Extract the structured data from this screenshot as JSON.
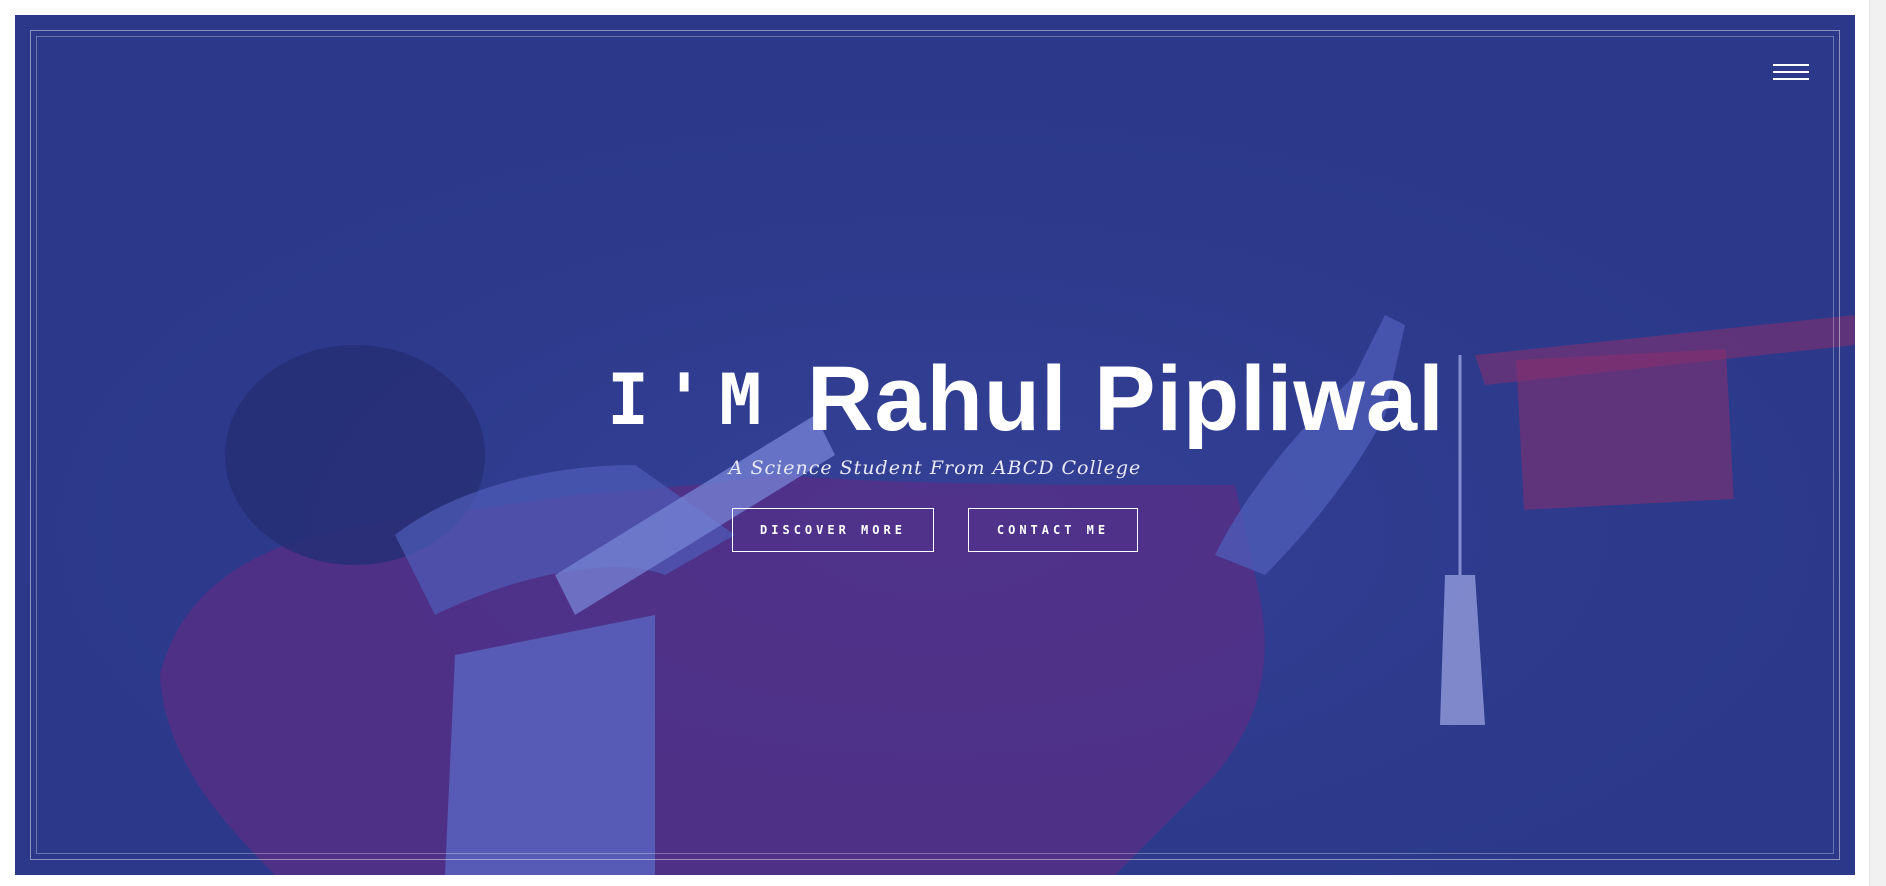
{
  "hero": {
    "intro": "I'M",
    "name": "Rahul Pipliwal",
    "subtitle": "A Science Student From ABCD College"
  },
  "buttons": {
    "discover_label": "DISCOVER MORE",
    "contact_label": "CONTACT ME"
  },
  "menu": {
    "icon": "hamburger-menu-icon"
  },
  "colors": {
    "overlay": "#2c398a",
    "accent": "#6a2a7d",
    "text": "#ffffff"
  }
}
